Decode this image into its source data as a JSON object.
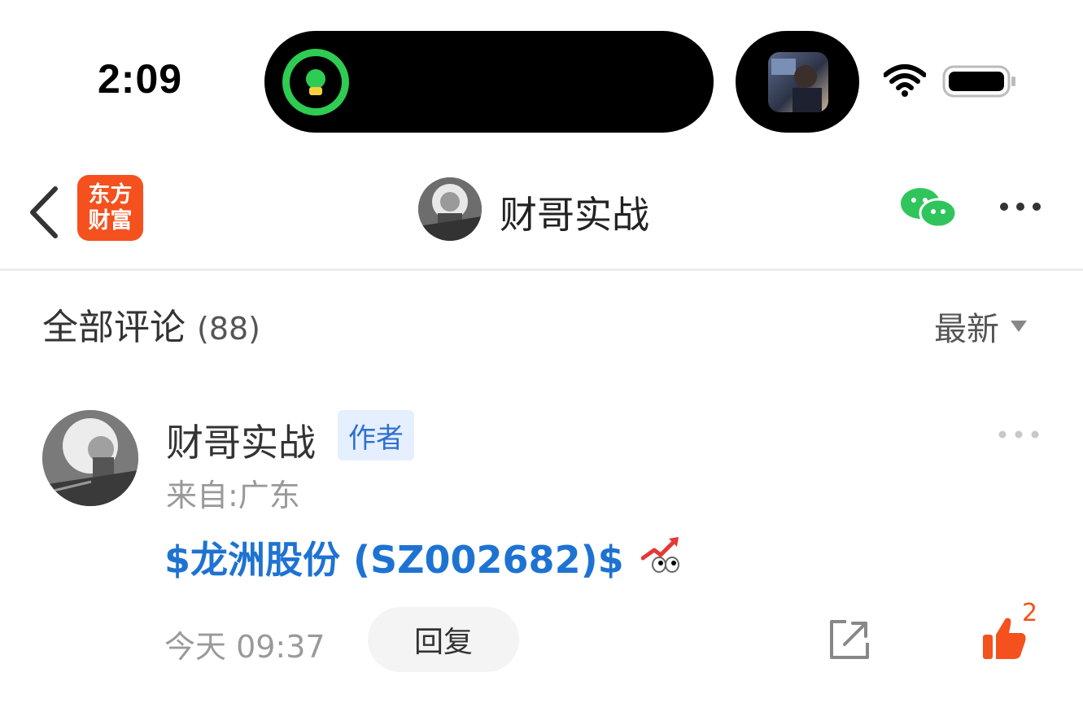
{
  "status_bar": {
    "time": "2:09"
  },
  "app": {
    "logo_line1": "东方",
    "logo_line2": "财富",
    "brand_color": "#f4511e"
  },
  "nav": {
    "title": "财哥实战"
  },
  "comments": {
    "header_label": "全部评论",
    "count": "(88)",
    "sort_label": "最新"
  },
  "comment": {
    "author": "财哥实战",
    "badge": "作者",
    "location": "来自:广东",
    "stock_text": "$龙洲股份 (SZ002682)$",
    "time": "今天 09:37",
    "reply_label": "回复",
    "like_count": "2",
    "link_color": "#1e73d2"
  }
}
